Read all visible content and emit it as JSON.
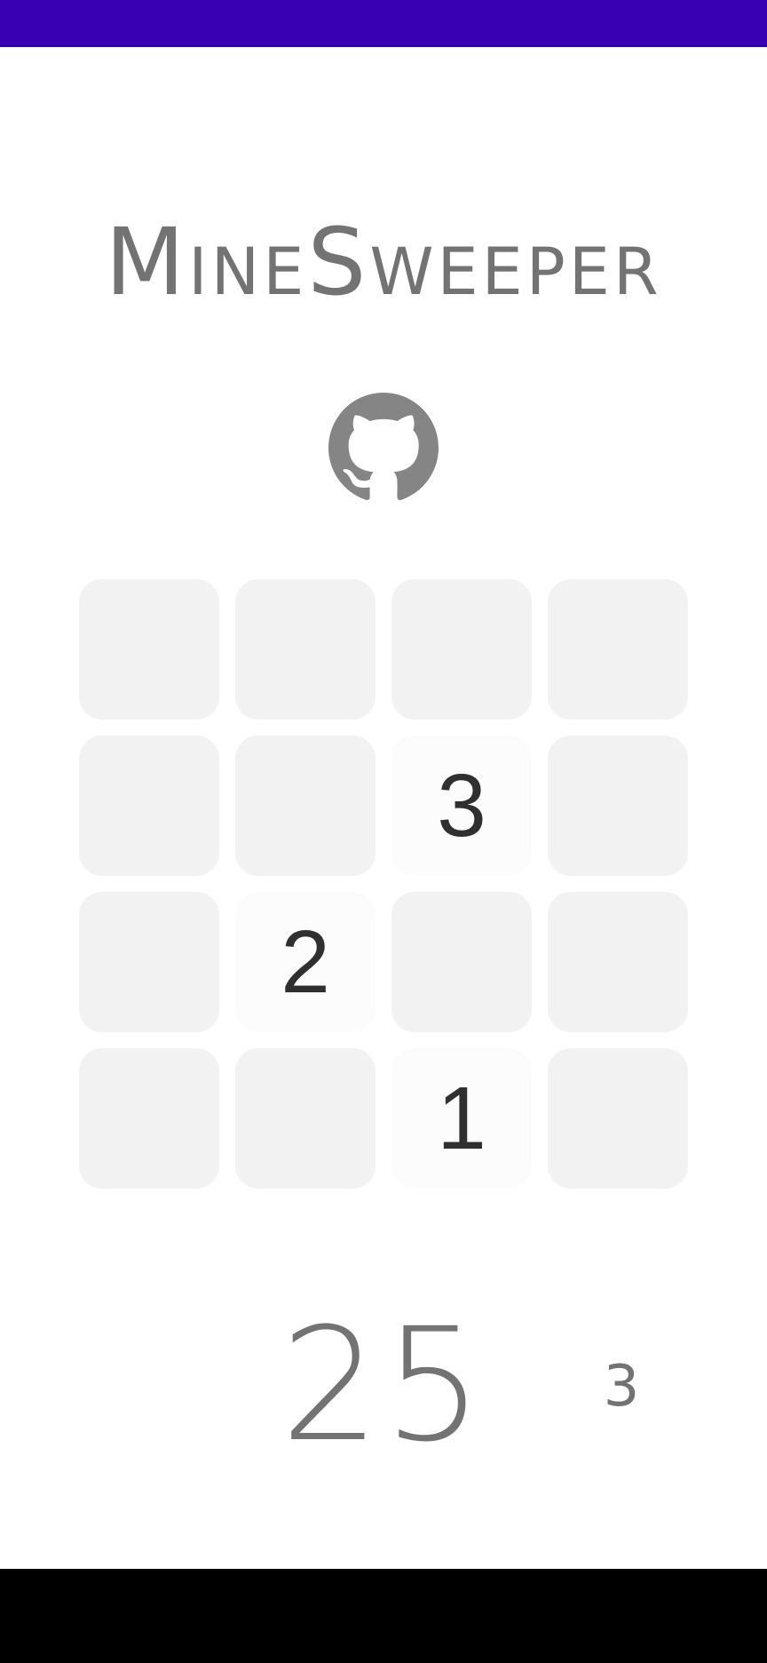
{
  "app": {
    "title": "MineSweeper"
  },
  "colors": {
    "status_bar": "#3700b3",
    "nav_bar": "#000000",
    "text_gray": "#737373",
    "cell_hidden": "#f2f2f2",
    "cell_revealed": "#fcfcfc",
    "cell_number": "#303030"
  },
  "github": {
    "icon": "github-icon"
  },
  "board": {
    "rows": 4,
    "cols": 4,
    "cells": [
      [
        "",
        "",
        "",
        ""
      ],
      [
        "",
        "",
        "3",
        ""
      ],
      [
        "",
        "2",
        "",
        ""
      ],
      [
        "",
        "",
        "1",
        ""
      ]
    ],
    "revealed": [
      [
        false,
        false,
        false,
        false
      ],
      [
        false,
        false,
        true,
        false
      ],
      [
        false,
        true,
        false,
        false
      ],
      [
        false,
        false,
        true,
        false
      ]
    ]
  },
  "footer": {
    "counter": "25",
    "mines_left": "3"
  }
}
